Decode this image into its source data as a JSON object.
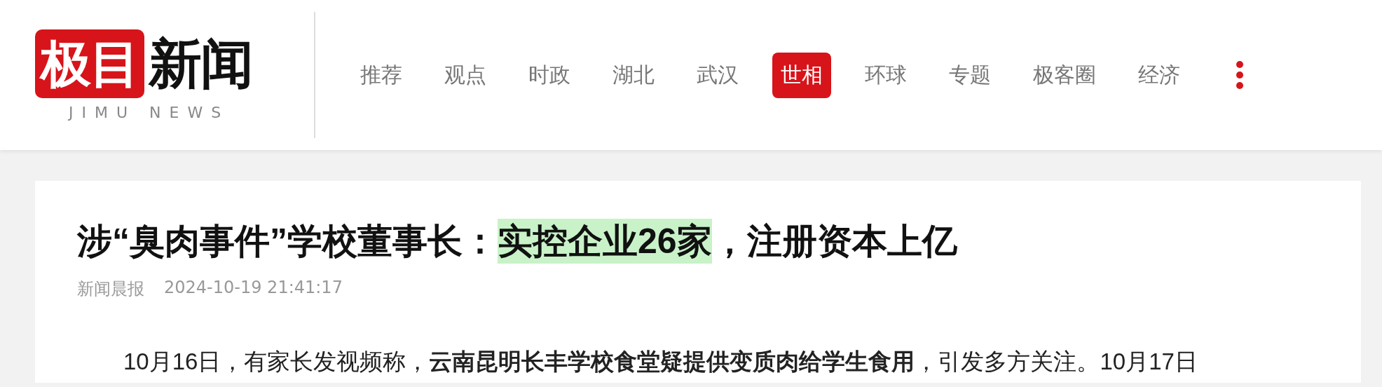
{
  "logo": {
    "mark": "极目",
    "name": "新闻",
    "tagline": "JIMU NEWS"
  },
  "nav": [
    {
      "label": "推荐",
      "selected": false
    },
    {
      "label": "观点",
      "selected": false
    },
    {
      "label": "时政",
      "selected": false
    },
    {
      "label": "湖北",
      "selected": false
    },
    {
      "label": "武汉",
      "selected": false
    },
    {
      "label": "世相",
      "selected": true
    },
    {
      "label": "环球",
      "selected": false
    },
    {
      "label": "专题",
      "selected": false
    },
    {
      "label": "极客圈",
      "selected": false
    },
    {
      "label": "经济",
      "selected": false
    }
  ],
  "article": {
    "title_parts": [
      {
        "text": "涉“臭肉事件”学校董事长：",
        "highlighted": false
      },
      {
        "text": "实控企业26家",
        "highlighted": true
      },
      {
        "text": "，注册资本上亿",
        "highlighted": false
      }
    ],
    "source": "新闻晨报",
    "time": "2024-10-19 21:41:17",
    "paragraph": "10月16日，有家长发视频称，**云南昆明长丰学校食堂疑提供变质肉给学生食用**，引发多方关注。10月17日"
  }
}
